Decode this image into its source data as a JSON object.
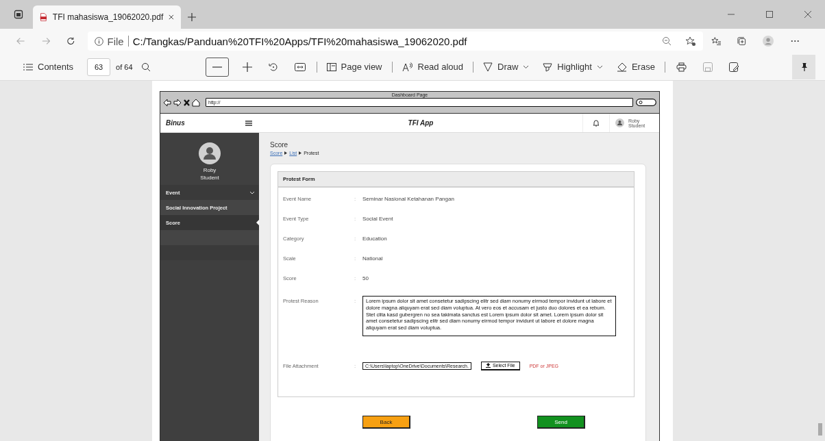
{
  "browser": {
    "tab": {
      "title": "TFI mahasiswa_19062020.pdf"
    },
    "address": {
      "scheme": "File",
      "url": "C:/Tangkas/Panduan%20TFI%20Apps/TFI%20mahasiswa_19062020.pdf"
    }
  },
  "pdf_toolbar": {
    "contents": "Contents",
    "page": "63",
    "page_count": "of 64",
    "tools": [
      {
        "label": "Page view",
        "kind": "button"
      },
      {
        "label": "Read aloud",
        "kind": "button"
      },
      {
        "label": "Draw",
        "kind": "dropdown"
      },
      {
        "label": "Highlight",
        "kind": "dropdown"
      },
      {
        "label": "Erase",
        "kind": "button"
      }
    ]
  },
  "mockup": {
    "window_title": "Dashboard Page",
    "url": "http://",
    "header": {
      "brand": "Binus",
      "title": "TFI App",
      "user_name": "Roby",
      "user_role": "Student"
    },
    "sidebar": {
      "user_name": "Roby",
      "user_role": "Student",
      "items": [
        {
          "label": "Event",
          "kind": "group",
          "selected": false
        },
        {
          "label": "Social Innovation Project",
          "kind": "link",
          "selected": false
        },
        {
          "label": "Score",
          "kind": "link",
          "selected": true
        }
      ]
    },
    "page_title": "Score",
    "breadcrumb": [
      {
        "label": "Score",
        "kind": "link"
      },
      {
        "label": "List",
        "kind": "link"
      },
      {
        "label": "Protest",
        "kind": "current"
      }
    ],
    "form": {
      "title": "Protest Form",
      "fields": [
        {
          "label": "Event Name",
          "separator": ":",
          "kind": "text",
          "value": "Seminar Nasional Ketahanan Pangan"
        },
        {
          "label": "Event Type",
          "separator": ":",
          "kind": "text",
          "value": "Social Event"
        },
        {
          "label": "Category",
          "separator": ":",
          "kind": "text",
          "value": "Education"
        },
        {
          "label": "Scale",
          "separator": ":",
          "kind": "text",
          "value": "National"
        },
        {
          "label": "Score",
          "separator": ":",
          "kind": "text",
          "value": "50"
        },
        {
          "label": "Protest Reason",
          "separator": ":",
          "kind": "textarea",
          "value": "Lorem ipsum dolor sit amet  consetetur sadipscing elitr sed diam nonumy eirmod tempor invidunt ut labore et dolore magna aliquyam erat  sed diam voluptua. At vero eos et accusam et justo duo dolores et ea rebum. Stet clita kasd gubergren  no sea takimata sanctus est Lorem ipsum dolor sit amet. Lorem ipsum dolor sit amet consetetur sadipscing elitr  sed diam nonumy eirmod tempor invidunt ut labore et dolore magna aliquyam erat  sed diam voluptua."
        },
        {
          "label": "File Attachment",
          "separator": ":",
          "kind": "file",
          "value": "C:\\Users\\laptop\\OneDrive\\Documents\\Research.",
          "button": "Select File",
          "hint": "PDF or JPEG"
        }
      ]
    },
    "buttons": [
      {
        "label": "Back",
        "kind": "back"
      },
      {
        "label": "Send",
        "kind": "send"
      }
    ]
  }
}
